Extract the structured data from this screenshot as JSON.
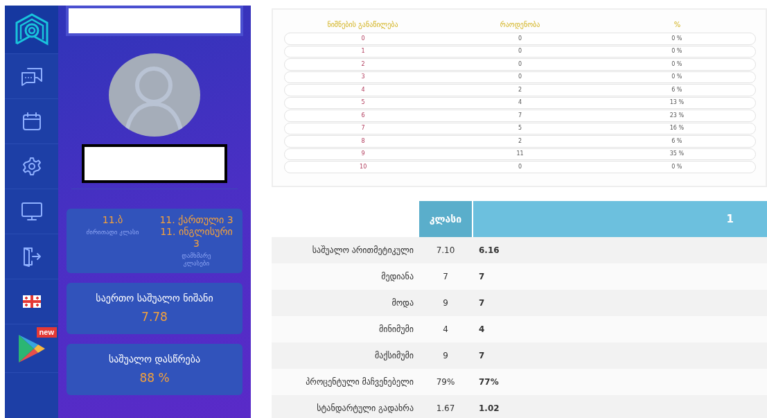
{
  "rail": [
    {
      "kind": "logo"
    },
    {
      "kind": "chat"
    },
    {
      "kind": "calendar"
    },
    {
      "kind": "settings"
    },
    {
      "kind": "monitor"
    },
    {
      "kind": "logout"
    },
    {
      "kind": "flag"
    },
    {
      "kind": "store",
      "badge": "new"
    }
  ],
  "profile": {
    "avatar": true,
    "main_class": {
      "value": "11.ბ",
      "label": "ძირითადი კლასი"
    },
    "extra_classes": {
      "values": [
        "11. ქართული 3",
        "11. ინგლისური 3"
      ],
      "label": "დამხმარე კლასები"
    }
  },
  "stat_cards": [
    {
      "label": "საერთო საშუალო ნიშანი",
      "value": "7.78"
    },
    {
      "label": "საშუალო დასწრება",
      "value": "88 %"
    }
  ],
  "distribution": {
    "columns": [
      "ნიშნების განაწილება",
      "რაოდენობა",
      "%"
    ],
    "rows": [
      [
        "0",
        "0",
        "0 %"
      ],
      [
        "1",
        "0",
        "0 %"
      ],
      [
        "2",
        "0",
        "0 %"
      ],
      [
        "3",
        "0",
        "0 %"
      ],
      [
        "4",
        "2",
        "6 %"
      ],
      [
        "5",
        "4",
        "13 %"
      ],
      [
        "6",
        "7",
        "23 %"
      ],
      [
        "7",
        "5",
        "16 %"
      ],
      [
        "8",
        "2",
        "6 %"
      ],
      [
        "9",
        "11",
        "35 %"
      ],
      [
        "10",
        "0",
        "0 %"
      ]
    ]
  },
  "stats": {
    "columns": [
      "კლასი",
      "1"
    ],
    "rows": [
      {
        "label": "საშუალო არითმეტიკული",
        "class": "7.10",
        "student": "6.16"
      },
      {
        "label": "მედიანა",
        "class": "7",
        "student": "7"
      },
      {
        "label": "მოდა",
        "class": "9",
        "student": "7"
      },
      {
        "label": "მინიმუმი",
        "class": "4",
        "student": "4"
      },
      {
        "label": "მაქსიმუმი",
        "class": "9",
        "student": "7"
      },
      {
        "label": "პროცენტული მაჩვენებელი",
        "class": "79%",
        "student": "77%"
      },
      {
        "label": "სტანდარტული გადახრა",
        "class": "1.67",
        "student": "1.02"
      }
    ]
  }
}
